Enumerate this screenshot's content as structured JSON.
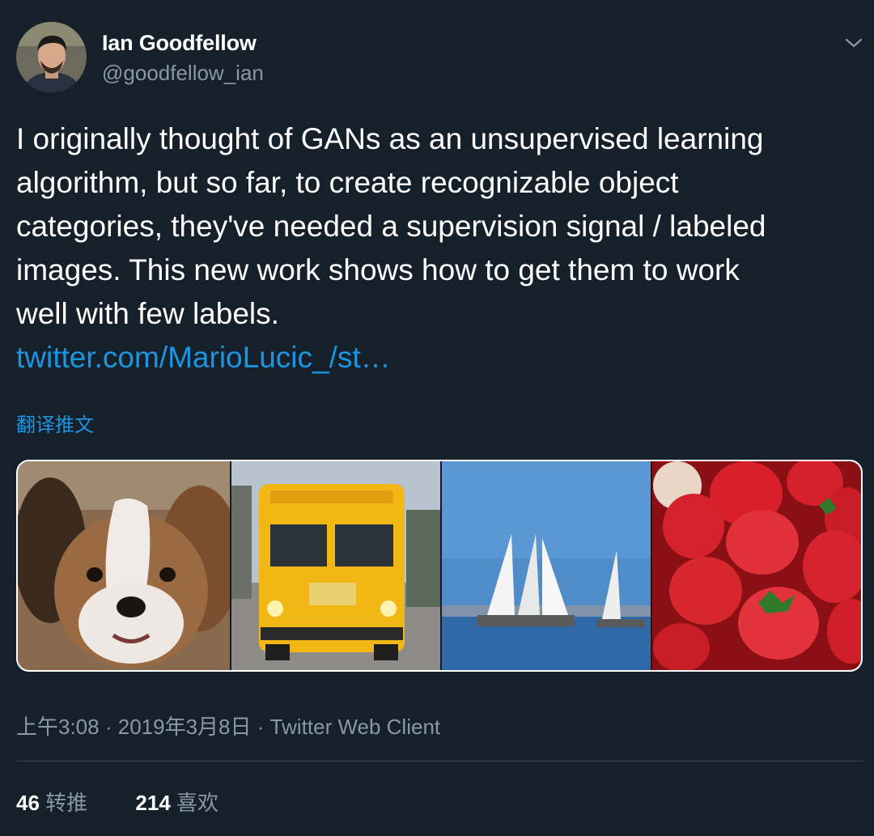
{
  "author": {
    "name": "Ian Goodfellow",
    "handle": "@goodfellow_ian"
  },
  "tweet": {
    "text": "I originally thought of GANs as an unsupervised learning\nalgorithm, but so far, to create recognizable object\ncategories, they've needed a supervision signal / labeled\nimages. This new work shows how to get them to work\nwell with few labels.",
    "link": "twitter.com/MarioLucic_/st…",
    "translate_label": "翻译推文"
  },
  "media": {
    "images": [
      "dog-photo",
      "school-bus-photo",
      "sailboats-photo",
      "strawberries-photo"
    ]
  },
  "meta": {
    "time": "上午3:08",
    "date": "2019年3月8日",
    "client": "Twitter Web Client",
    "separator": "·"
  },
  "stats": {
    "retweets_count": "46",
    "retweets_label": "转推",
    "likes_count": "214",
    "likes_label": "喜欢"
  },
  "colors": {
    "background": "#15202b",
    "accent": "#1b95e0",
    "secondary_text": "#8899a6",
    "divider": "#38444d"
  },
  "icons": {
    "more": "chevron-down-icon"
  }
}
